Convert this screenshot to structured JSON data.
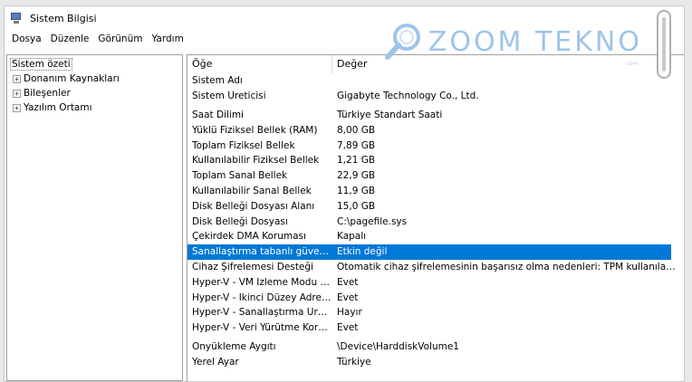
{
  "window": {
    "title": "Sistem Bilgisi"
  },
  "menu": [
    "Dosya",
    "Düzenle",
    "Görünüm",
    "Yardım"
  ],
  "tree": {
    "root": "Sistem özeti",
    "children": [
      "Donanım Kaynakları",
      "Bileşenler",
      "Yazılım Ortamı"
    ]
  },
  "grid": {
    "headers": {
      "item": "Öğe",
      "value": "Değer"
    },
    "rows": [
      {
        "item": "Sistem Adı",
        "value": ""
      },
      {
        "item": "Sistem Üreticisi",
        "value": "Gigabyte Technology Co., Ltd."
      },
      {
        "item": "Saat Dilimi",
        "value": "Türkiye Standart Saati"
      },
      {
        "item": "Yüklü Fiziksel Bellek (RAM)",
        "value": "8,00 GB"
      },
      {
        "item": "Toplam Fiziksel Bellek",
        "value": "7,89 GB"
      },
      {
        "item": "Kullanılabilir Fiziksel Bellek",
        "value": "1,21 GB"
      },
      {
        "item": "Toplam Sanal Bellek",
        "value": "22,9 GB"
      },
      {
        "item": "Kullanılabilir Sanal Bellek",
        "value": "11,9 GB"
      },
      {
        "item": "Disk Belleği Dosyası Alanı",
        "value": "15,0 GB"
      },
      {
        "item": "Disk Belleği Dosyası",
        "value": "C:\\pagefile.sys"
      },
      {
        "item": "Çekirdek DMA Koruması",
        "value": "Kapalı"
      },
      {
        "item": "Sanallaştırma tabanlı güvenlik",
        "value": "Etkin değil"
      },
      {
        "item": "Cihaz Şifrelemesi Desteği",
        "value": "Otomatik cihaz şifrelemesinin başarısız olma nedenleri: TPM kullanılamıyor, PC..."
      },
      {
        "item": "Hyper-V - VM İzleme Modu Uz...",
        "value": "Evet"
      },
      {
        "item": "Hyper-V - İkinci Düzey Adres Ç...",
        "value": "Evet"
      },
      {
        "item": "Hyper-V - Sanallaştırma Üretici ...",
        "value": "Hayır"
      },
      {
        "item": "Hyper-V - Veri Yürütme Korum...",
        "value": "Evet"
      },
      {
        "item": "Önyükleme Aygıtı",
        "value": "\\Device\\HarddiskVolume1"
      },
      {
        "item": "Yerel Ayar",
        "value": "Türkiye"
      }
    ]
  },
  "watermark": {
    "brand": "ZOOM TEKNO",
    "sub": ".com",
    "color": "#9fc4ea"
  },
  "colors": {
    "selection": "#0078d7"
  }
}
